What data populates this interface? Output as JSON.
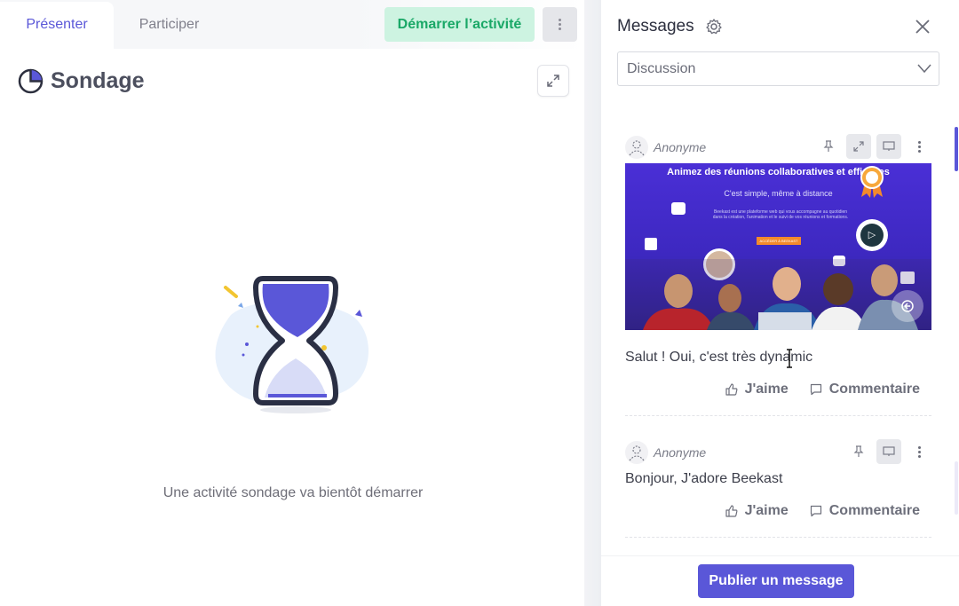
{
  "left_panel": {
    "tabs": [
      {
        "label": "Présenter",
        "active": true
      },
      {
        "label": "Participer",
        "active": false
      }
    ],
    "start_button_label": "Démarrer l’activité",
    "activity_title": "Sondage",
    "waiting_message": "Une activité sondage va bientôt démarrer",
    "icons": {
      "activity": "pie-chart-icon",
      "menu": "kebab-menu-icon",
      "expand": "expand-icon",
      "illustration": "hourglass-icon"
    }
  },
  "right_panel": {
    "title": "Messages",
    "icons": {
      "settings": "gear-icon",
      "close": "close-icon",
      "dropdown": "chevron-down-icon"
    },
    "channel_select": {
      "selected": "Discussion"
    },
    "posts": [
      {
        "author": "Anonyme",
        "has_image": true,
        "image": {
          "headline": "Animez des réunions collaboratives et efficaces",
          "subline": "C'est simple, même à distance"
        },
        "text": "Salut ! Oui, c'est très dynamic",
        "like_label": "J'aime",
        "comment_label": "Commentaire"
      },
      {
        "author": "Anonyme",
        "has_image": false,
        "text": "Bonjour, J'adore Beekast",
        "like_label": "J'aime",
        "comment_label": "Commentaire"
      }
    ],
    "publish_button_label": "Publier un message"
  },
  "colors": {
    "accent": "#5a57d8",
    "start_button_bg": "#cdf3e1",
    "start_button_text": "#1aa867"
  }
}
